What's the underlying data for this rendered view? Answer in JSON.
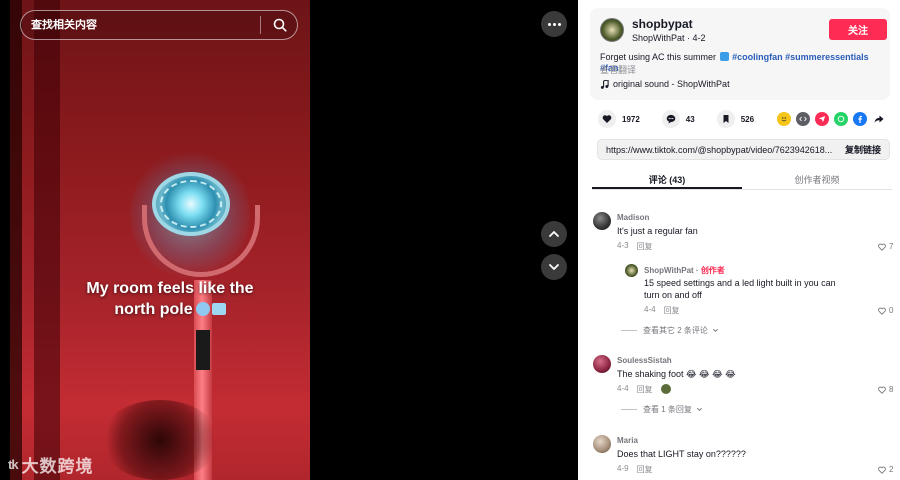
{
  "search": {
    "placeholder": "查找相关内容"
  },
  "video": {
    "caption_line1": "My room feels like the",
    "caption_line2": "north pole"
  },
  "watermark": {
    "logo": "tk",
    "text": "大数跨境"
  },
  "author": {
    "username": "shopbypat",
    "display": "ShopWithPat · 4-2",
    "follow_label": "关注",
    "desc_text": "Forget using AC this summer",
    "hashtags": [
      "#coolingfan",
      "#summeressentials",
      "#fan"
    ],
    "translate_label": "查看翻译",
    "sound": "original sound - ShopWithPat"
  },
  "actions": {
    "likes": "1972",
    "comments": "43",
    "saves": "526"
  },
  "share_icons": [
    "emoji-share-icon",
    "embed-icon",
    "send-icon",
    "whatsapp-icon",
    "facebook-icon",
    "forward-arrow-icon"
  ],
  "link": {
    "url": "https://www.tiktok.com/@shopbypat/video/7623942618...",
    "copy_label": "复制链接"
  },
  "tabs": {
    "comments": "评论 (43)",
    "creator_videos": "创作者视频"
  },
  "comments": [
    {
      "user": "Madison",
      "text": "It's just a regular fan",
      "date": "4-3",
      "reply_label": "回复",
      "likes": "7"
    },
    {
      "user": "ShopWithPat",
      "creator_label": "创作者",
      "text_line1": "15 speed settings and a led light built in you can",
      "text_line2": "turn on and off",
      "date": "4-4",
      "reply_label": "回复",
      "likes": "0",
      "more_replies": "查看其它 2 条评论"
    },
    {
      "user": "SoulessSistah",
      "text": "The shaking foot 😂 😂 😂 😂",
      "date": "4-4",
      "reply_label": "回复",
      "likes": "8",
      "more_replies": "查看 1 条回复"
    },
    {
      "user": "Maria",
      "text": "Does that LIGHT stay on??????",
      "date": "4-9",
      "reply_label": "回复",
      "likes": "2"
    }
  ],
  "colors": {
    "accent": "#fe2c55",
    "hashtag": "#2b5db9",
    "panel_bg": "#ffffff"
  }
}
